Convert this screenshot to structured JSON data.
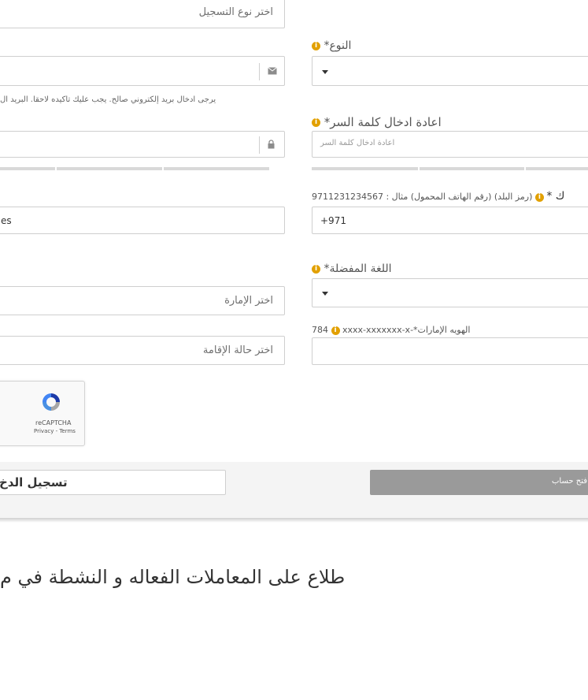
{
  "form": {
    "registration_type_placeholder": "اختر نوع التسجيل",
    "email": {
      "help_text": "يرجى ادخال بريد إلكتروني صالح. يجب عليك تأكيده لاحقا. البريد ال"
    },
    "gender": {
      "label": "النوع*",
      "info": "i"
    },
    "password_confirm": {
      "label": "اعادة ادخال كلمة السر*",
      "placeholder": "اعادة ادخال كلمة السر",
      "info": "i"
    },
    "phone": {
      "label_prefix": "ك *",
      "label_rest": "(رمز البلد) (رقم الهاتف المحمول) مثال : 9711231234567",
      "value": "+971",
      "info": "i"
    },
    "nationality": {
      "value": "es"
    },
    "language": {
      "label": "اللغة المفضلة*",
      "info": "i"
    },
    "emirate_placeholder": "اختر الإمارة",
    "emirates_id": {
      "label": "784 الهويه الإمارات*-xxxx-xxxxxxx-x",
      "label_left": "784",
      "label_right": "الهويه الإمارات*-xxxx-xxxxxxx-x",
      "info": "i"
    },
    "residency_placeholder": "اختر حالة الإقامة",
    "recaptcha": {
      "brand": "reCAPTCHA",
      "links": "Privacy - Terms"
    }
  },
  "actions": {
    "login_label": "تسجيل الدخ",
    "open_account_label": "فتح حساب"
  },
  "footer_text": "طلاع على المعاملات الفعاله و النشطة في م",
  "colors": {
    "accent_info": "#e2a000",
    "button_gray": "#9a9a9a",
    "border": "#cfcfcf"
  }
}
